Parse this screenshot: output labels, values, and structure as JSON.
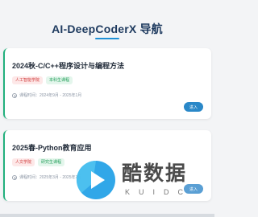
{
  "header": {
    "title": "AI-DeepCoderX 导航"
  },
  "courses": [
    {
      "title": "2024秋-C/C++程序设计与编程方法",
      "tags": [
        "人工智能学院",
        "本科生课程"
      ],
      "time": "课程时间：2024年9月 - 2025年1月",
      "button_label": "进入"
    },
    {
      "title": "2025春-Python教育应用",
      "tags": [
        "人文学院",
        "研究生课程"
      ],
      "time": "课程时间：2025年3月 - 2025年7月",
      "button_label": "进入"
    }
  ],
  "watermark": {
    "text": "酷数据",
    "subtext": "KUIDC"
  },
  "colors": {
    "accent": "#22b07d",
    "button": "#2a88c8",
    "title": "#1e3a5f",
    "underline": "#1e90d6"
  },
  "icons": {
    "time": "clock-icon",
    "watermark": "play-logo-icon"
  }
}
